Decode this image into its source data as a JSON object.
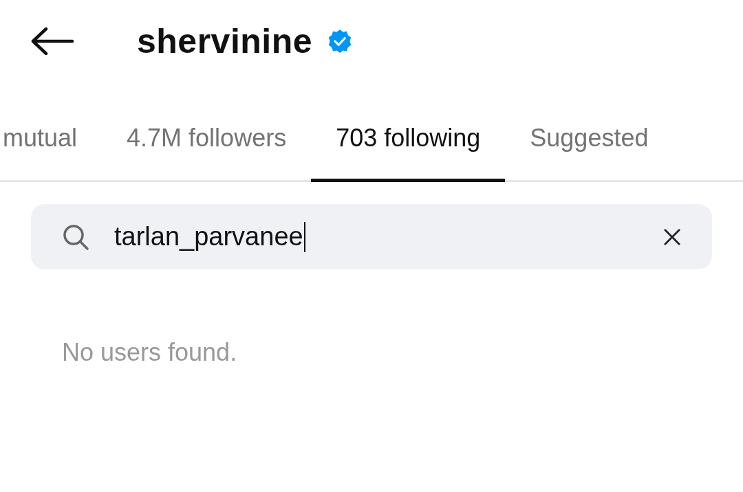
{
  "header": {
    "title": "shervinine",
    "verified": true
  },
  "tabs": [
    {
      "label": "mutual",
      "selected": false
    },
    {
      "label": "4.7M followers",
      "selected": false
    },
    {
      "label": "703 following",
      "selected": true
    },
    {
      "label": "Suggested",
      "selected": false
    }
  ],
  "search": {
    "value": "tarlan_parvanee"
  },
  "empty_message": "No users found."
}
